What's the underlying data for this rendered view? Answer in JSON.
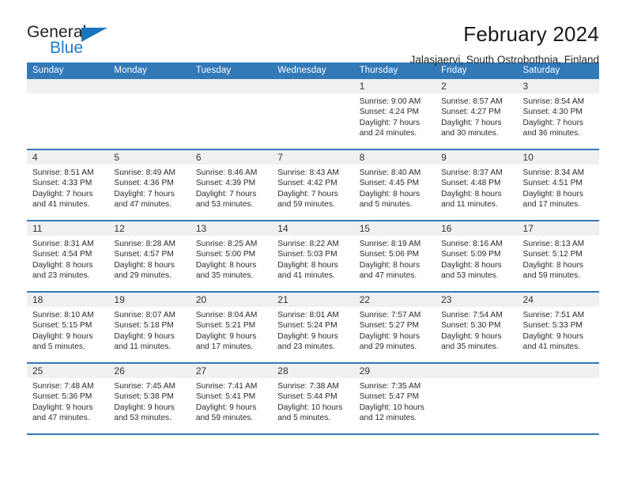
{
  "logo": {
    "word1": "General",
    "word2": "Blue",
    "triangle_color": "#1a74bd",
    "text_color": "#231f20",
    "accent_color": "#1f7ac4"
  },
  "header": {
    "title": "February 2024",
    "location": "Jalasjaervi, South Ostrobothnia, Finland"
  },
  "theme": {
    "header_bg": "#3279b8",
    "header_text": "#ffffff",
    "daynum_bg": "#f0f0f0",
    "row_border": "#3279b8"
  },
  "calendar": {
    "weekdays": [
      "Sunday",
      "Monday",
      "Tuesday",
      "Wednesday",
      "Thursday",
      "Friday",
      "Saturday"
    ],
    "labels": {
      "sunrise": "Sunrise:",
      "sunset": "Sunset:",
      "daylight": "Daylight:"
    },
    "weeks": [
      [
        {
          "day": "",
          "empty": true
        },
        {
          "day": "",
          "empty": true
        },
        {
          "day": "",
          "empty": true
        },
        {
          "day": "",
          "empty": true
        },
        {
          "day": "1",
          "sunrise": "Sunrise: 9:00 AM",
          "sunset": "Sunset: 4:24 PM",
          "daylight1": "Daylight: 7 hours",
          "daylight2": "and 24 minutes."
        },
        {
          "day": "2",
          "sunrise": "Sunrise: 8:57 AM",
          "sunset": "Sunset: 4:27 PM",
          "daylight1": "Daylight: 7 hours",
          "daylight2": "and 30 minutes."
        },
        {
          "day": "3",
          "sunrise": "Sunrise: 8:54 AM",
          "sunset": "Sunset: 4:30 PM",
          "daylight1": "Daylight: 7 hours",
          "daylight2": "and 36 minutes."
        }
      ],
      [
        {
          "day": "4",
          "sunrise": "Sunrise: 8:51 AM",
          "sunset": "Sunset: 4:33 PM",
          "daylight1": "Daylight: 7 hours",
          "daylight2": "and 41 minutes."
        },
        {
          "day": "5",
          "sunrise": "Sunrise: 8:49 AM",
          "sunset": "Sunset: 4:36 PM",
          "daylight1": "Daylight: 7 hours",
          "daylight2": "and 47 minutes."
        },
        {
          "day": "6",
          "sunrise": "Sunrise: 8:46 AM",
          "sunset": "Sunset: 4:39 PM",
          "daylight1": "Daylight: 7 hours",
          "daylight2": "and 53 minutes."
        },
        {
          "day": "7",
          "sunrise": "Sunrise: 8:43 AM",
          "sunset": "Sunset: 4:42 PM",
          "daylight1": "Daylight: 7 hours",
          "daylight2": "and 59 minutes."
        },
        {
          "day": "8",
          "sunrise": "Sunrise: 8:40 AM",
          "sunset": "Sunset: 4:45 PM",
          "daylight1": "Daylight: 8 hours",
          "daylight2": "and 5 minutes."
        },
        {
          "day": "9",
          "sunrise": "Sunrise: 8:37 AM",
          "sunset": "Sunset: 4:48 PM",
          "daylight1": "Daylight: 8 hours",
          "daylight2": "and 11 minutes."
        },
        {
          "day": "10",
          "sunrise": "Sunrise: 8:34 AM",
          "sunset": "Sunset: 4:51 PM",
          "daylight1": "Daylight: 8 hours",
          "daylight2": "and 17 minutes."
        }
      ],
      [
        {
          "day": "11",
          "sunrise": "Sunrise: 8:31 AM",
          "sunset": "Sunset: 4:54 PM",
          "daylight1": "Daylight: 8 hours",
          "daylight2": "and 23 minutes."
        },
        {
          "day": "12",
          "sunrise": "Sunrise: 8:28 AM",
          "sunset": "Sunset: 4:57 PM",
          "daylight1": "Daylight: 8 hours",
          "daylight2": "and 29 minutes."
        },
        {
          "day": "13",
          "sunrise": "Sunrise: 8:25 AM",
          "sunset": "Sunset: 5:00 PM",
          "daylight1": "Daylight: 8 hours",
          "daylight2": "and 35 minutes."
        },
        {
          "day": "14",
          "sunrise": "Sunrise: 8:22 AM",
          "sunset": "Sunset: 5:03 PM",
          "daylight1": "Daylight: 8 hours",
          "daylight2": "and 41 minutes."
        },
        {
          "day": "15",
          "sunrise": "Sunrise: 8:19 AM",
          "sunset": "Sunset: 5:06 PM",
          "daylight1": "Daylight: 8 hours",
          "daylight2": "and 47 minutes."
        },
        {
          "day": "16",
          "sunrise": "Sunrise: 8:16 AM",
          "sunset": "Sunset: 5:09 PM",
          "daylight1": "Daylight: 8 hours",
          "daylight2": "and 53 minutes."
        },
        {
          "day": "17",
          "sunrise": "Sunrise: 8:13 AM",
          "sunset": "Sunset: 5:12 PM",
          "daylight1": "Daylight: 8 hours",
          "daylight2": "and 59 minutes."
        }
      ],
      [
        {
          "day": "18",
          "sunrise": "Sunrise: 8:10 AM",
          "sunset": "Sunset: 5:15 PM",
          "daylight1": "Daylight: 9 hours",
          "daylight2": "and 5 minutes."
        },
        {
          "day": "19",
          "sunrise": "Sunrise: 8:07 AM",
          "sunset": "Sunset: 5:18 PM",
          "daylight1": "Daylight: 9 hours",
          "daylight2": "and 11 minutes."
        },
        {
          "day": "20",
          "sunrise": "Sunrise: 8:04 AM",
          "sunset": "Sunset: 5:21 PM",
          "daylight1": "Daylight: 9 hours",
          "daylight2": "and 17 minutes."
        },
        {
          "day": "21",
          "sunrise": "Sunrise: 8:01 AM",
          "sunset": "Sunset: 5:24 PM",
          "daylight1": "Daylight: 9 hours",
          "daylight2": "and 23 minutes."
        },
        {
          "day": "22",
          "sunrise": "Sunrise: 7:57 AM",
          "sunset": "Sunset: 5:27 PM",
          "daylight1": "Daylight: 9 hours",
          "daylight2": "and 29 minutes."
        },
        {
          "day": "23",
          "sunrise": "Sunrise: 7:54 AM",
          "sunset": "Sunset: 5:30 PM",
          "daylight1": "Daylight: 9 hours",
          "daylight2": "and 35 minutes."
        },
        {
          "day": "24",
          "sunrise": "Sunrise: 7:51 AM",
          "sunset": "Sunset: 5:33 PM",
          "daylight1": "Daylight: 9 hours",
          "daylight2": "and 41 minutes."
        }
      ],
      [
        {
          "day": "25",
          "sunrise": "Sunrise: 7:48 AM",
          "sunset": "Sunset: 5:36 PM",
          "daylight1": "Daylight: 9 hours",
          "daylight2": "and 47 minutes."
        },
        {
          "day": "26",
          "sunrise": "Sunrise: 7:45 AM",
          "sunset": "Sunset: 5:38 PM",
          "daylight1": "Daylight: 9 hours",
          "daylight2": "and 53 minutes."
        },
        {
          "day": "27",
          "sunrise": "Sunrise: 7:41 AM",
          "sunset": "Sunset: 5:41 PM",
          "daylight1": "Daylight: 9 hours",
          "daylight2": "and 59 minutes."
        },
        {
          "day": "28",
          "sunrise": "Sunrise: 7:38 AM",
          "sunset": "Sunset: 5:44 PM",
          "daylight1": "Daylight: 10 hours",
          "daylight2": "and 5 minutes."
        },
        {
          "day": "29",
          "sunrise": "Sunrise: 7:35 AM",
          "sunset": "Sunset: 5:47 PM",
          "daylight1": "Daylight: 10 hours",
          "daylight2": "and 12 minutes."
        },
        {
          "day": "",
          "empty": true
        },
        {
          "day": "",
          "empty": true
        }
      ]
    ]
  }
}
